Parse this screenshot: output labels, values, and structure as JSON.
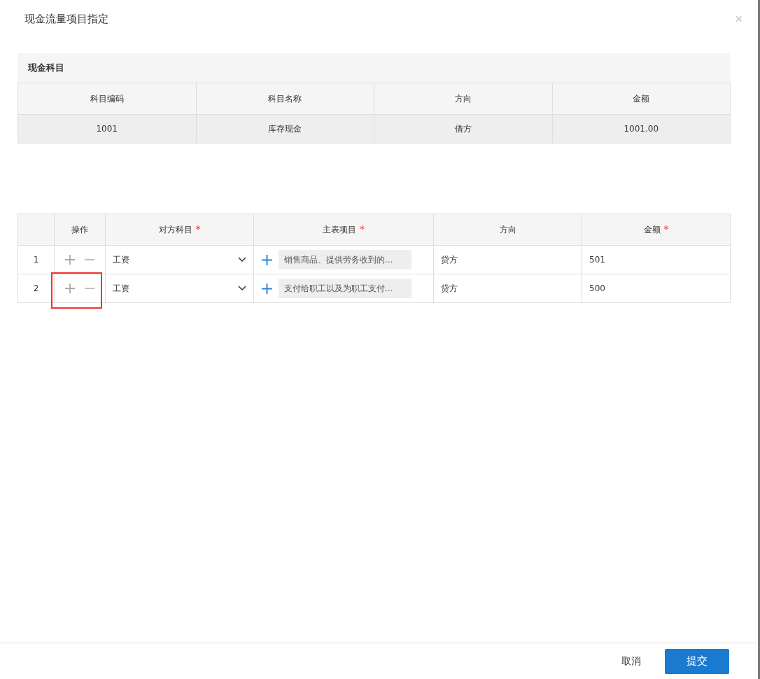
{
  "dialog": {
    "title": "现金流量项目指定",
    "close": "×"
  },
  "cash_account": {
    "title": "现金科目",
    "columns": [
      "科目编码",
      "科目名称",
      "方向",
      "金额"
    ],
    "rows": [
      {
        "cells": [
          "1001",
          "库存现金",
          "借方",
          "1001.00"
        ]
      }
    ]
  },
  "detail_table": {
    "required_mark": "*",
    "columns": [
      {},
      {
        "label": "操作",
        "required": false
      },
      {
        "label": "对方科目",
        "required": true
      },
      {
        "label": "主表项目",
        "required": true
      },
      {
        "label": "方向",
        "required": false
      },
      {
        "label": "金额",
        "required": true
      }
    ],
    "rows": [
      {
        "index": "1",
        "account": "工资",
        "item": "销售商品、提供劳务收到的...",
        "direction": "贷方",
        "amount": "501",
        "highlighted": false
      },
      {
        "index": "2",
        "account": "工资",
        "item": "支付给职工以及为职工支付...",
        "direction": "贷方",
        "amount": "500",
        "highlighted": true
      }
    ]
  },
  "footer": {
    "cancel": "取消",
    "submit": "提交"
  }
}
